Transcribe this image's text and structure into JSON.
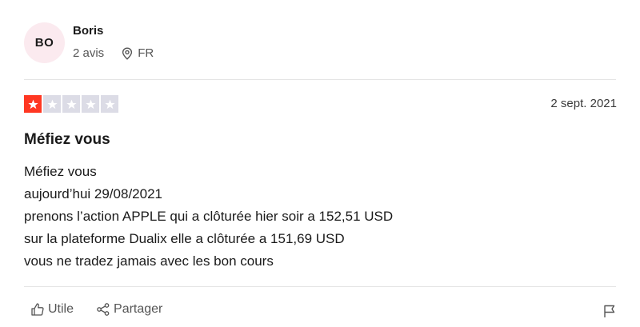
{
  "reviewer": {
    "initials": "BO",
    "name": "Boris",
    "reviews_count": "2 avis",
    "country": "FR"
  },
  "review": {
    "rating": 1,
    "max_rating": 5,
    "date": "2 sept. 2021",
    "title": "Méfiez vous",
    "body_lines": [
      "Méfiez vous",
      "aujourd’hui 29/08/2021",
      "prenons l’action APPLE qui a clôturée hier soir a 152,51 USD",
      "sur la plateforme Dualix elle a clôturée a 151,69 USD",
      "vous ne tradez jamais avec les bon cours"
    ]
  },
  "actions": {
    "useful_label": "Utile",
    "share_label": "Partager"
  },
  "colors": {
    "star_filled": "#ff3722",
    "star_empty": "#dcdce6",
    "avatar_bg": "#fbeaef"
  },
  "icons": {
    "location": "location-pin-icon",
    "like": "thumbs-up-icon",
    "share": "share-icon",
    "flag": "flag-icon",
    "star": "star-icon"
  }
}
